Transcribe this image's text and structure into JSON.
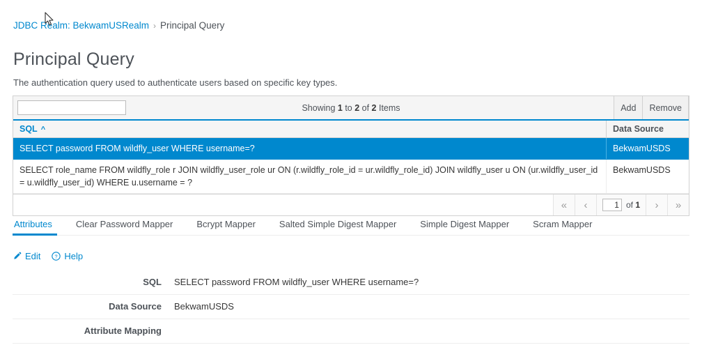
{
  "breadcrumb": {
    "parent": "JDBC Realm: BekwamUSRealm",
    "separator": "›",
    "current": "Principal Query"
  },
  "page": {
    "title": "Principal Query",
    "description": "The authentication query used to authenticate users based on specific key types."
  },
  "table": {
    "search_placeholder": "",
    "search_value": "",
    "showing": {
      "prefix": "Showing ",
      "from": "1",
      "mid": " to ",
      "to": "2",
      "mid2": " of ",
      "total": "2",
      "suffix": " Items"
    },
    "add_label": "Add",
    "remove_label": "Remove",
    "columns": {
      "sql": "SQL",
      "sort_caret": "^",
      "data_source": "Data Source"
    },
    "rows": [
      {
        "sql": "SELECT password FROM wildfly_user WHERE username=?",
        "data_source": "BekwamUSDS",
        "selected": true
      },
      {
        "sql": "SELECT role_name FROM wildfly_role r JOIN wildfly_user_role ur ON (r.wildfly_role_id = ur.wildfly_role_id) JOIN wildfly_user u ON (ur.wildfly_user_id = u.wildfly_user_id) WHERE u.username = ?",
        "data_source": "BekwamUSDS",
        "selected": false
      }
    ],
    "pagination": {
      "first": "«",
      "prev": "‹",
      "page_value": "1",
      "of_label": "of ",
      "total_pages": "1",
      "next": "›",
      "last": "»"
    }
  },
  "tabs": [
    {
      "label": "Attributes",
      "active": true
    },
    {
      "label": "Clear Password Mapper",
      "active": false
    },
    {
      "label": "Bcrypt Mapper",
      "active": false
    },
    {
      "label": "Salted Simple Digest Mapper",
      "active": false
    },
    {
      "label": "Simple Digest Mapper",
      "active": false
    },
    {
      "label": "Scram Mapper",
      "active": false
    }
  ],
  "actions": {
    "edit_label": "Edit",
    "help_label": "Help"
  },
  "detail": {
    "rows": [
      {
        "label": "SQL",
        "value": "SELECT password FROM wildfly_user WHERE username=?"
      },
      {
        "label": "Data Source",
        "value": "BekwamUSDS"
      },
      {
        "label": "Attribute Mapping",
        "value": ""
      }
    ]
  },
  "colors": {
    "accent": "#0088ce",
    "text": "#4d5258",
    "border": "#d1d1d1"
  }
}
